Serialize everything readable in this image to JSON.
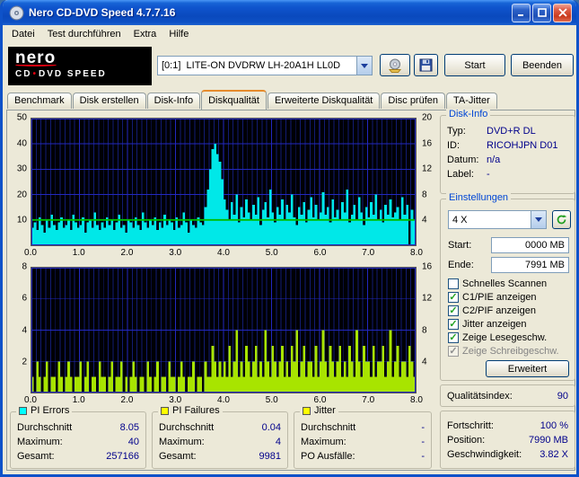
{
  "window": {
    "title": "Nero CD-DVD Speed 4.7.7.16"
  },
  "menu": {
    "items": [
      "Datei",
      "Test durchführen",
      "Extra",
      "Hilfe"
    ]
  },
  "toolbar": {
    "logo": {
      "brand": "nero",
      "sub_left": "CD",
      "sub_dot": "•",
      "sub_right": "DVD",
      "sub_speed": " SPEED"
    },
    "drive_select": {
      "value": "[0:1]  LITE-ON DVDRW LH-20A1H LL0D"
    },
    "start_label": "Start",
    "quit_label": "Beenden"
  },
  "tabs": [
    {
      "label": "Benchmark",
      "active": false
    },
    {
      "label": "Disk erstellen",
      "active": false
    },
    {
      "label": "Disk-Info",
      "active": false
    },
    {
      "label": "Diskqualität",
      "active": true
    },
    {
      "label": "Erweiterte Diskqualität",
      "active": false
    },
    {
      "label": "Disc prüfen",
      "active": false
    },
    {
      "label": "TA-Jitter",
      "active": false
    }
  ],
  "charts": {
    "x_ticks": [
      "0.0",
      "1.0",
      "2.0",
      "3.0",
      "4.0",
      "5.0",
      "6.0",
      "7.0",
      "8.0"
    ],
    "top": {
      "name": "PI Errors scan",
      "left_ticks": [
        "50",
        "40",
        "30",
        "20",
        "10"
      ],
      "right_ticks": [
        "20",
        "16",
        "12",
        "8",
        "4"
      ],
      "left_max": 50,
      "right_max": 20,
      "series_color": "#00E8E8",
      "speed_line": {
        "color": "#00BE00",
        "value": 4
      },
      "values": [
        7,
        9,
        6,
        11,
        8,
        5,
        10,
        7,
        12,
        8,
        6,
        9,
        11,
        7,
        8,
        10,
        6,
        12,
        9,
        7,
        8,
        11,
        5,
        9,
        10,
        7,
        13,
        8,
        6,
        9,
        7,
        11,
        8,
        10,
        6,
        9,
        12,
        7,
        8,
        5,
        10,
        9,
        7,
        11,
        8,
        6,
        13,
        9,
        7,
        10,
        8,
        11,
        6,
        9,
        7,
        12,
        8,
        10,
        9,
        6,
        11,
        7,
        8,
        13,
        9,
        5,
        10,
        8,
        7,
        11,
        9,
        8,
        15,
        22,
        30,
        38,
        40,
        36,
        33,
        26,
        18,
        14,
        10,
        17,
        12,
        20,
        9,
        15,
        11,
        18,
        13,
        10,
        16,
        12,
        19,
        8,
        14,
        17,
        11,
        22,
        13,
        9,
        15,
        12,
        18,
        10,
        16,
        13,
        20,
        11,
        8,
        15,
        12,
        17,
        9,
        14,
        19,
        11,
        16,
        10,
        13,
        21,
        12,
        15,
        9,
        18,
        11,
        14,
        10,
        17,
        13,
        22,
        9,
        12,
        16,
        10,
        19,
        13,
        8,
        15,
        11,
        17,
        12,
        20,
        10,
        14,
        9,
        16,
        12,
        18,
        11,
        13,
        15,
        10,
        19,
        12,
        16,
        0,
        14,
        10
      ]
    },
    "bottom": {
      "name": "PI Failures scan",
      "left_ticks": [
        "8",
        "6",
        "4",
        "2"
      ],
      "right_ticks": [
        "16",
        "12",
        "8",
        "4"
      ],
      "left_max": 8,
      "right_max": 16,
      "series_color": "#A8E400",
      "speed_line": null,
      "values": [
        1,
        0,
        2,
        1,
        0,
        1,
        2,
        0,
        1,
        1,
        0,
        2,
        1,
        0,
        1,
        2,
        1,
        0,
        1,
        1,
        2,
        0,
        1,
        2,
        0,
        1,
        1,
        0,
        2,
        1,
        1,
        0,
        1,
        2,
        0,
        1,
        1,
        2,
        0,
        1,
        0,
        1,
        2,
        1,
        0,
        1,
        1,
        0,
        2,
        1,
        0,
        1,
        2,
        0,
        1,
        1,
        0,
        2,
        1,
        1,
        0,
        1,
        2,
        1,
        0,
        1,
        1,
        2,
        0,
        1,
        1,
        0,
        2,
        1,
        1,
        3,
        2,
        1,
        2,
        1,
        2,
        1,
        3,
        1,
        2,
        4,
        1,
        2,
        1,
        3,
        2,
        1,
        2,
        3,
        1,
        2,
        1,
        4,
        2,
        1,
        3,
        2,
        1,
        2,
        3,
        1,
        2,
        1,
        3,
        2,
        4,
        1,
        2,
        3,
        1,
        2,
        2,
        1,
        3,
        1,
        2,
        4,
        2,
        1,
        3,
        2,
        1,
        2,
        3,
        1,
        2,
        1,
        3,
        2,
        1,
        4,
        2,
        1,
        3,
        2,
        2,
        1,
        3,
        1,
        2,
        2,
        3,
        1,
        2,
        4,
        1,
        2,
        3,
        1,
        2,
        2,
        1,
        3,
        2,
        1
      ]
    }
  },
  "stats_groups": [
    {
      "id": "pi-errors",
      "title": "PI Errors",
      "swatch": "#00FFFF",
      "rows": [
        [
          "Durchschnitt",
          "8.05"
        ],
        [
          "Maximum:",
          "40"
        ],
        [
          "Gesamt:",
          "257166"
        ]
      ]
    },
    {
      "id": "pi-failures",
      "title": "PI Failures",
      "swatch": "#FFFF00",
      "rows": [
        [
          "Durchschnitt",
          "0.04"
        ],
        [
          "Maximum:",
          "4"
        ],
        [
          "Gesamt:",
          "9981"
        ]
      ]
    },
    {
      "id": "jitter",
      "title": "Jitter",
      "swatch": "#FFFF00",
      "rows": [
        [
          "Durchschnitt",
          "-"
        ],
        [
          "Maximum:",
          "-"
        ],
        [
          "PO Ausfälle:",
          "-"
        ]
      ]
    }
  ],
  "sidebar": {
    "disk_info": {
      "title": "Disk-Info",
      "rows": [
        [
          "Typ:",
          "DVD+R DL"
        ],
        [
          "ID:",
          "RICOHJPN D01"
        ],
        [
          "Datum:",
          "n/a"
        ],
        [
          "Label:",
          "-"
        ]
      ]
    },
    "settings": {
      "title": "Einstellungen",
      "speed_select": "4 X",
      "start_label": "Start:",
      "start_value": "0000 MB",
      "end_label": "Ende:",
      "end_value": "7991 MB",
      "checkboxes": [
        {
          "label": "Schnelles Scannen",
          "checked": false,
          "disabled": false
        },
        {
          "label": "C1/PIE anzeigen",
          "checked": true,
          "disabled": false
        },
        {
          "label": "C2/PIF anzeigen",
          "checked": true,
          "disabled": false
        },
        {
          "label": "Jitter anzeigen",
          "checked": true,
          "disabled": false
        },
        {
          "label": "Zeige Lesegeschw.",
          "checked": true,
          "disabled": false
        },
        {
          "label": "Zeige Schreibgeschw.",
          "checked": true,
          "disabled": true
        }
      ],
      "advanced_label": "Erweitert"
    },
    "quality": {
      "label": "Qualitätsindex:",
      "value": "90"
    },
    "progress": {
      "rows": [
        [
          "Fortschritt:",
          "100 %"
        ],
        [
          "Position:",
          "7990 MB"
        ],
        [
          "Geschwindigkeit:",
          "3.82 X"
        ]
      ]
    }
  }
}
